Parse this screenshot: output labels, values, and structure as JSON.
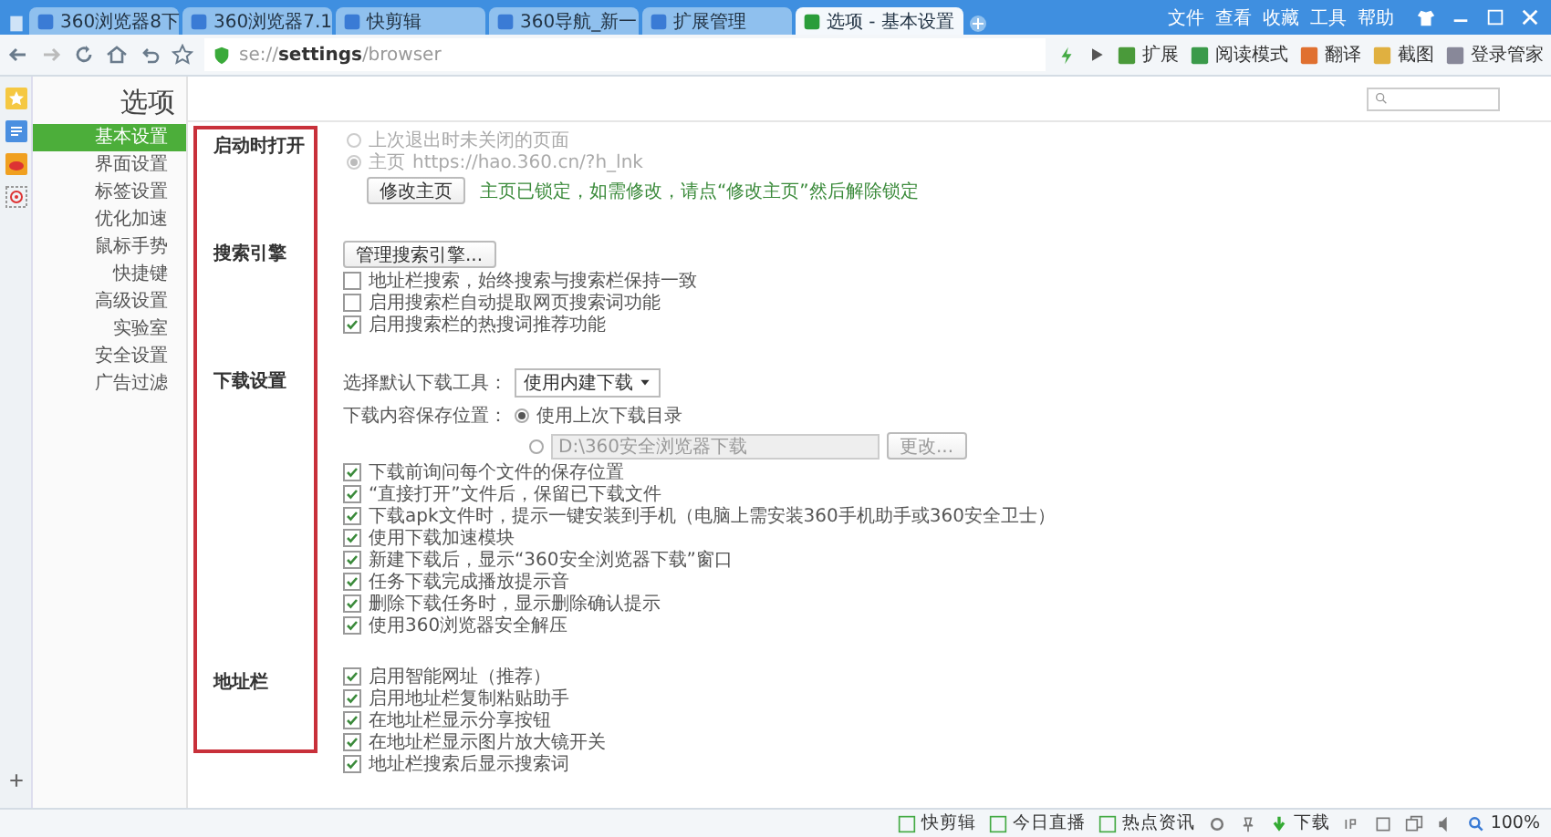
{
  "browser": {
    "tabs": [
      {
        "label": "360浏览器8下",
        "selected": false
      },
      {
        "label": "360浏览器7.1",
        "selected": false
      },
      {
        "label": "快剪辑",
        "selected": false
      },
      {
        "label": "360导航_新一",
        "selected": false
      },
      {
        "label": "扩展管理",
        "selected": false
      },
      {
        "label": "选项 - 基本设置",
        "selected": true
      }
    ],
    "menu": [
      "文件",
      "查看",
      "收藏",
      "工具",
      "帮助"
    ],
    "address": "se://**settings**/browser",
    "toolbar": [
      "扩展",
      "阅读模式",
      "翻译",
      "截图",
      "登录管家"
    ]
  },
  "page": {
    "title": "选项"
  },
  "nav": [
    {
      "label": "基本设置",
      "selected": true
    },
    {
      "label": "界面设置",
      "selected": false
    },
    {
      "label": "标签设置",
      "selected": false
    },
    {
      "label": "优化加速",
      "selected": false
    },
    {
      "label": "鼠标手势",
      "selected": false
    },
    {
      "label": "快捷键",
      "selected": false
    },
    {
      "label": "高级设置",
      "selected": false
    },
    {
      "label": "实验室",
      "selected": false
    },
    {
      "label": "安全设置",
      "selected": false
    },
    {
      "label": "广告过滤",
      "selected": false
    }
  ],
  "sections": [
    {
      "label": "启动时打开",
      "items": [
        {
          "kind": "radio",
          "label": "上次退出时未关闭的页面",
          "selected": false,
          "disabled": true
        },
        {
          "kind": "radio",
          "label": "主页",
          "value": "https://hao.360.cn/?h_lnk",
          "selected": true,
          "disabled": true
        },
        {
          "kind": "button_note",
          "button": "修改主页",
          "note": "主页已锁定，如需修改，请点“修改主页”然后解除锁定"
        }
      ]
    },
    {
      "label": "搜索引擎",
      "items": [
        {
          "kind": "button",
          "button": "管理搜索引擎..."
        },
        {
          "kind": "checkbox",
          "label": "地址栏搜索，始终搜索与搜索栏保持一致",
          "checked": false
        },
        {
          "kind": "checkbox",
          "label": "启用搜索栏自动提取网页搜索词功能",
          "checked": false
        },
        {
          "kind": "checkbox",
          "label": "启用搜索栏的热搜词推荐功能",
          "checked": true
        }
      ]
    },
    {
      "label": "下载设置",
      "items": [
        {
          "kind": "select",
          "label": "选择默认下载工具：",
          "value": "使用内建下载"
        },
        {
          "kind": "radio_group",
          "label": "下载内容保存位置：",
          "options": [
            {
              "label": "使用上次下载目录",
              "selected": true
            },
            {
              "path": "D:\\360安全浏览器下载",
              "button": "更改...",
              "selected": false
            }
          ]
        },
        {
          "kind": "checkbox",
          "label": "下载前询问每个文件的保存位置",
          "checked": true
        },
        {
          "kind": "checkbox",
          "label": "“直接打开”文件后，保留已下载文件",
          "checked": true
        },
        {
          "kind": "checkbox",
          "label": "下载apk文件时，提示一键安装到手机（电脑上需安装360手机助手或360安全卫士）",
          "checked": true
        },
        {
          "kind": "checkbox",
          "label": "使用下载加速模块",
          "checked": true
        },
        {
          "kind": "checkbox",
          "label": "新建下载后，显示“360安全浏览器下载”窗口",
          "checked": true
        },
        {
          "kind": "checkbox",
          "label": "任务下载完成播放提示音",
          "checked": true
        },
        {
          "kind": "checkbox",
          "label": "删除下载任务时，显示删除确认提示",
          "checked": true
        },
        {
          "kind": "checkbox",
          "label": "使用360浏览器安全解压",
          "checked": true
        }
      ]
    },
    {
      "label": "地址栏",
      "items": [
        {
          "kind": "checkbox",
          "label": "启用智能网址（推荐）",
          "checked": true
        },
        {
          "kind": "checkbox",
          "label": "启用地址栏复制粘贴助手",
          "checked": true
        },
        {
          "kind": "checkbox",
          "label": "在地址栏显示分享按钮",
          "checked": true
        },
        {
          "kind": "checkbox",
          "label": "在地址栏显示图片放大镜开关",
          "checked": true
        },
        {
          "kind": "checkbox",
          "label": "地址栏搜索后显示搜索词",
          "checked": true
        }
      ]
    }
  ],
  "status_bar": {
    "left": [
      "快剪辑",
      "今日直播",
      "热点资讯"
    ],
    "download": "下载",
    "zoom": "100%"
  }
}
